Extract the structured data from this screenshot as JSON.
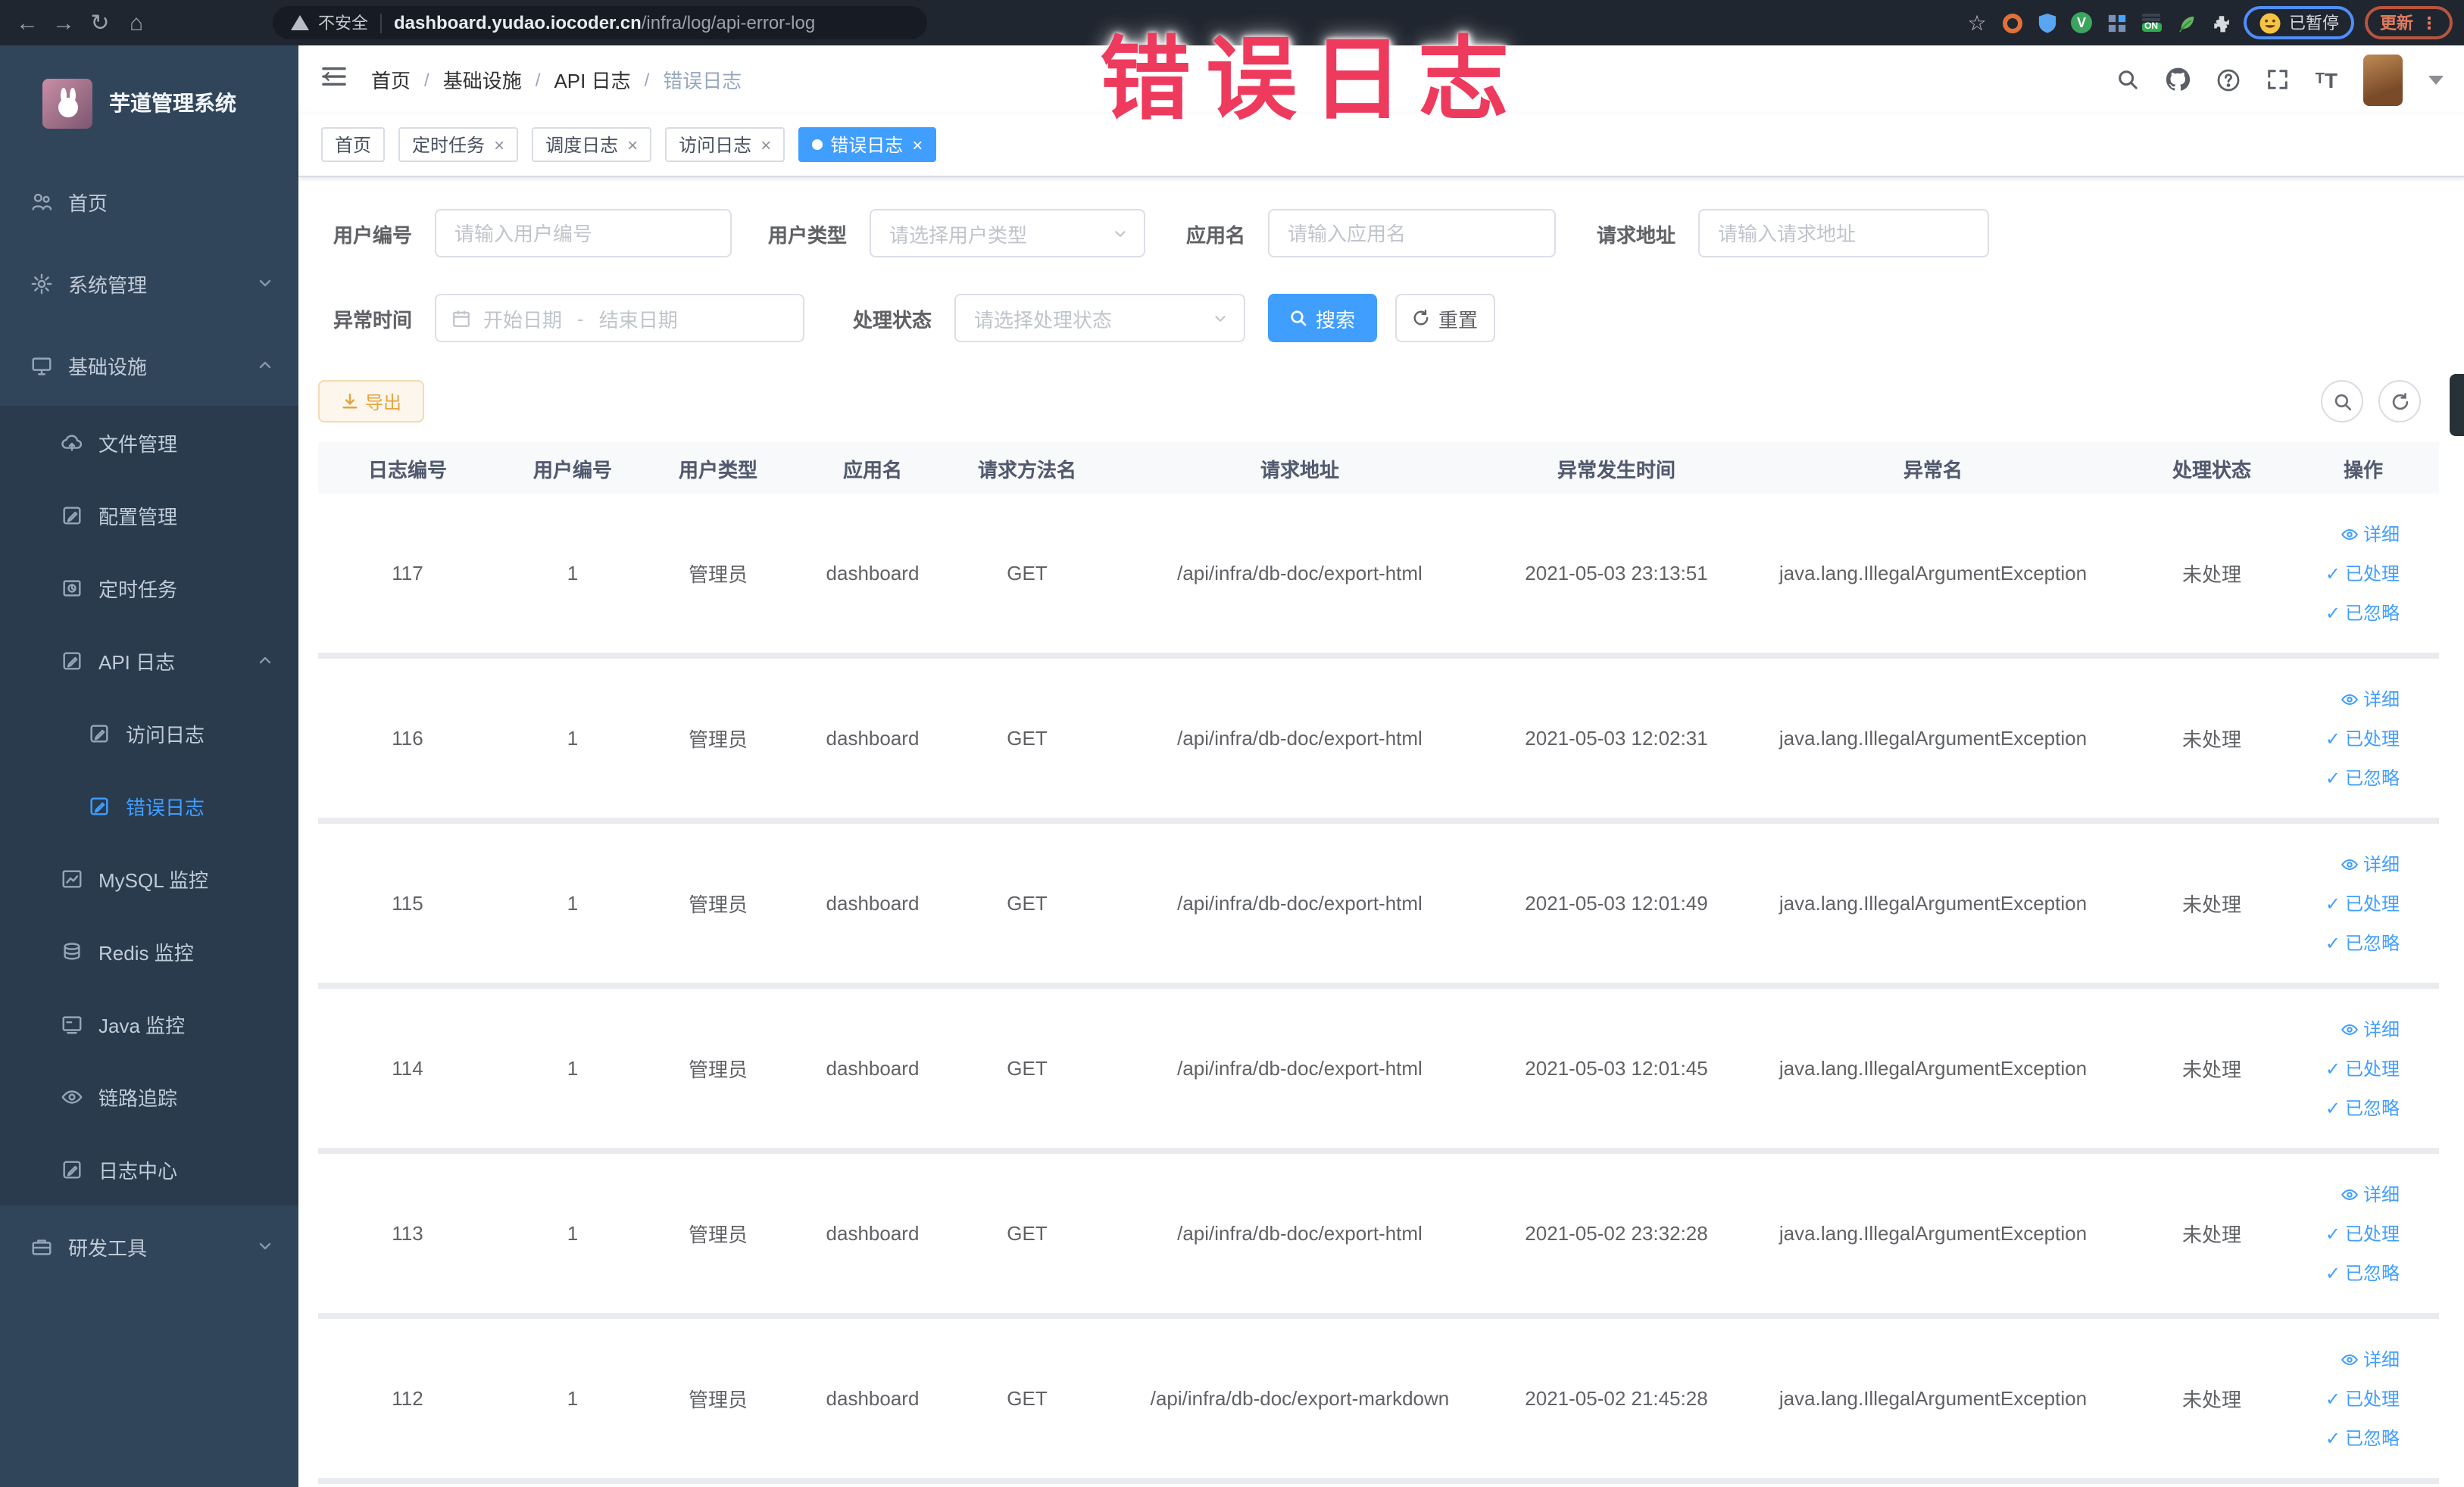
{
  "overlay": {
    "text": "错误日志",
    "color": "#ee3a5d"
  },
  "browser": {
    "insecure_label": "不安全",
    "url_host": "dashboard.yudao.iocoder.cn",
    "url_path": "/infra/log/api-error-log",
    "paused_label": "已暂停",
    "update_label": "更新"
  },
  "sidebar": {
    "title": "芋道管理系统",
    "items": [
      {
        "label": "首页"
      },
      {
        "label": "系统管理"
      },
      {
        "label": "基础设施"
      },
      {
        "label": "文件管理"
      },
      {
        "label": "配置管理"
      },
      {
        "label": "定时任务"
      },
      {
        "label": "API 日志"
      },
      {
        "label": "访问日志"
      },
      {
        "label": "错误日志"
      },
      {
        "label": "MySQL 监控"
      },
      {
        "label": "Redis 监控"
      },
      {
        "label": "Java 监控"
      },
      {
        "label": "链路追踪"
      },
      {
        "label": "日志中心"
      },
      {
        "label": "研发工具"
      }
    ]
  },
  "breadcrumb": [
    "首页",
    "基础设施",
    "API 日志",
    "错误日志"
  ],
  "tabs": [
    {
      "label": "首页"
    },
    {
      "label": "定时任务"
    },
    {
      "label": "调度日志"
    },
    {
      "label": "访问日志"
    },
    {
      "label": "错误日志"
    }
  ],
  "filters": {
    "user_id_label": "用户编号",
    "user_id_placeholder": "请输入用户编号",
    "user_type_label": "用户类型",
    "user_type_placeholder": "请选择用户类型",
    "app_name_label": "应用名",
    "app_name_placeholder": "请输入应用名",
    "request_url_label": "请求地址",
    "request_url_placeholder": "请输入请求地址",
    "exception_time_label": "异常时间",
    "date_start_placeholder": "开始日期",
    "date_separator": "-",
    "date_end_placeholder": "结束日期",
    "process_status_label": "处理状态",
    "process_status_placeholder": "请选择处理状态",
    "search_label": "搜索",
    "reset_label": "重置"
  },
  "toolbar": {
    "export_label": "导出"
  },
  "table": {
    "columns": [
      "日志编号",
      "用户编号",
      "用户类型",
      "应用名",
      "请求方法名",
      "请求地址",
      "异常发生时间",
      "异常名",
      "处理状态",
      "操作"
    ],
    "rows": [
      [
        "117",
        "1",
        "管理员",
        "dashboard",
        "GET",
        "/api/infra/db-doc/export-html",
        "2021-05-03 23:13:51",
        "java.lang.IllegalArgumentException",
        "未处理"
      ],
      [
        "116",
        "1",
        "管理员",
        "dashboard",
        "GET",
        "/api/infra/db-doc/export-html",
        "2021-05-03 12:02:31",
        "java.lang.IllegalArgumentException",
        "未处理"
      ],
      [
        "115",
        "1",
        "管理员",
        "dashboard",
        "GET",
        "/api/infra/db-doc/export-html",
        "2021-05-03 12:01:49",
        "java.lang.IllegalArgumentException",
        "未处理"
      ],
      [
        "114",
        "1",
        "管理员",
        "dashboard",
        "GET",
        "/api/infra/db-doc/export-html",
        "2021-05-03 12:01:45",
        "java.lang.IllegalArgumentException",
        "未处理"
      ],
      [
        "113",
        "1",
        "管理员",
        "dashboard",
        "GET",
        "/api/infra/db-doc/export-html",
        "2021-05-02 23:32:28",
        "java.lang.IllegalArgumentException",
        "未处理"
      ],
      [
        "112",
        "1",
        "管理员",
        "dashboard",
        "GET",
        "/api/infra/db-doc/export-markdown",
        "2021-05-02 21:45:28",
        "java.lang.IllegalArgumentException",
        "未处理"
      ]
    ],
    "actions": {
      "detail": "详细",
      "processed": "已处理",
      "ignored": "已忽略"
    }
  }
}
